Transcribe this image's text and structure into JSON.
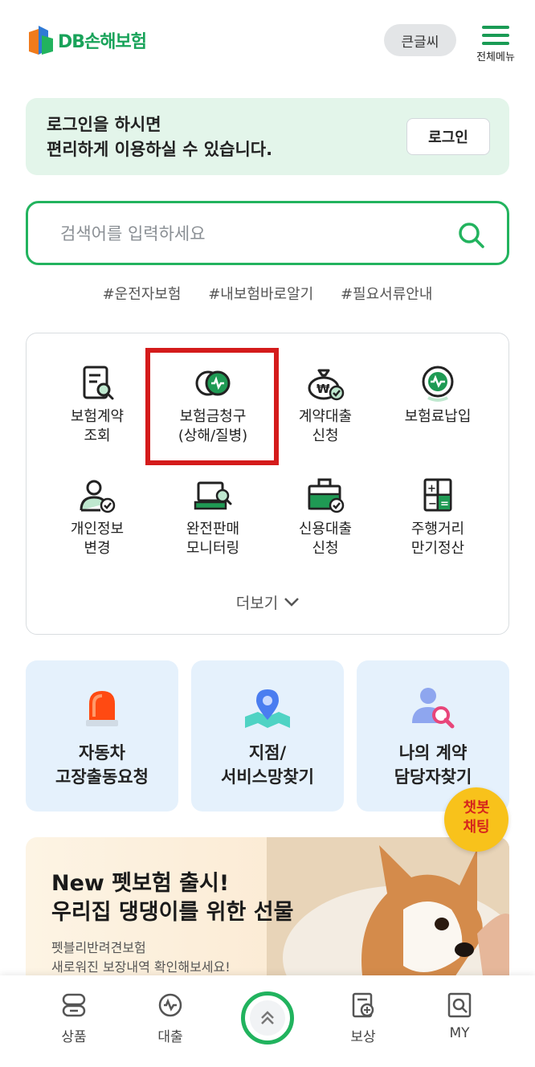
{
  "header": {
    "logo_text": "DB손해보험",
    "bigfont_label": "큰글씨",
    "menu_label": "전체메뉴"
  },
  "login_banner": {
    "line1": "로그인을 하시면",
    "line2": "편리하게 이용하실 수 있습니다.",
    "button": "로그인"
  },
  "search": {
    "placeholder": "검색어를 입력하세요",
    "tags": [
      "#운전자보험",
      "#내보험바로알기",
      "#필요서류안내"
    ]
  },
  "quick_menu": {
    "items": [
      {
        "label": "보험계약\n조회",
        "icon": "document-search-icon"
      },
      {
        "label": "보험금청구\n(상해/질병)",
        "icon": "coin-claim-icon"
      },
      {
        "label": "계약대출\n신청",
        "icon": "money-bag-icon"
      },
      {
        "label": "보험료납입",
        "icon": "payment-coin-icon"
      },
      {
        "label": "개인정보\n변경",
        "icon": "user-check-icon"
      },
      {
        "label": "완전판매\n모니터링",
        "icon": "laptop-search-icon"
      },
      {
        "label": "신용대출\n신청",
        "icon": "briefcase-check-icon"
      },
      {
        "label": "주행거리\n만기정산",
        "icon": "calculator-icon"
      }
    ],
    "more_label": "더보기"
  },
  "services": [
    {
      "label": "자동차\n고장출동요청",
      "icon": "siren-icon"
    },
    {
      "label": "지점/\n서비스망찾기",
      "icon": "map-pin-icon"
    },
    {
      "label": "나의 계약\n담당자찾기",
      "icon": "person-search-icon"
    }
  ],
  "chatbot": {
    "line1": "챗봇",
    "line2": "채팅"
  },
  "promo": {
    "title": "New 펫보험 출시!\n우리집 댕댕이를 위한 선물",
    "subtitle": "펫블리반려견보험\n새로워진 보장내역 확인해보세요!"
  },
  "bottom_nav": {
    "items": [
      {
        "label": "상품",
        "icon": "product-icon"
      },
      {
        "label": "대출",
        "icon": "loan-icon"
      },
      {
        "label": "",
        "icon": "scroll-top-icon"
      },
      {
        "label": "보상",
        "icon": "compensation-icon"
      },
      {
        "label": "MY",
        "icon": "my-icon"
      }
    ]
  },
  "colors": {
    "brand_green": "#22b35e",
    "highlight_red": "#d41b1b",
    "chatbot_yellow": "#f8c21b"
  }
}
